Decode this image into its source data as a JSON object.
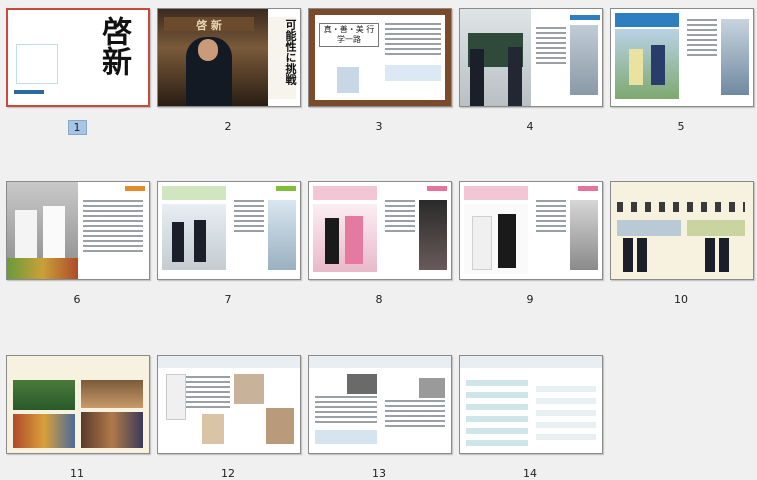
{
  "pages": [
    {
      "number": "1",
      "title": "啓新",
      "selected": true
    },
    {
      "number": "2",
      "title": "可能性に挑戦"
    },
    {
      "number": "3",
      "title": "真・善・美 行学一路"
    },
    {
      "number": "4"
    },
    {
      "number": "5"
    },
    {
      "number": "6"
    },
    {
      "number": "7"
    },
    {
      "number": "8"
    },
    {
      "number": "9"
    },
    {
      "number": "10"
    },
    {
      "number": "11"
    },
    {
      "number": "12"
    },
    {
      "number": "13"
    },
    {
      "number": "14"
    }
  ],
  "colors": {
    "selected_border": "#c94a3a",
    "selected_label_bg": "#a7c6e6"
  }
}
